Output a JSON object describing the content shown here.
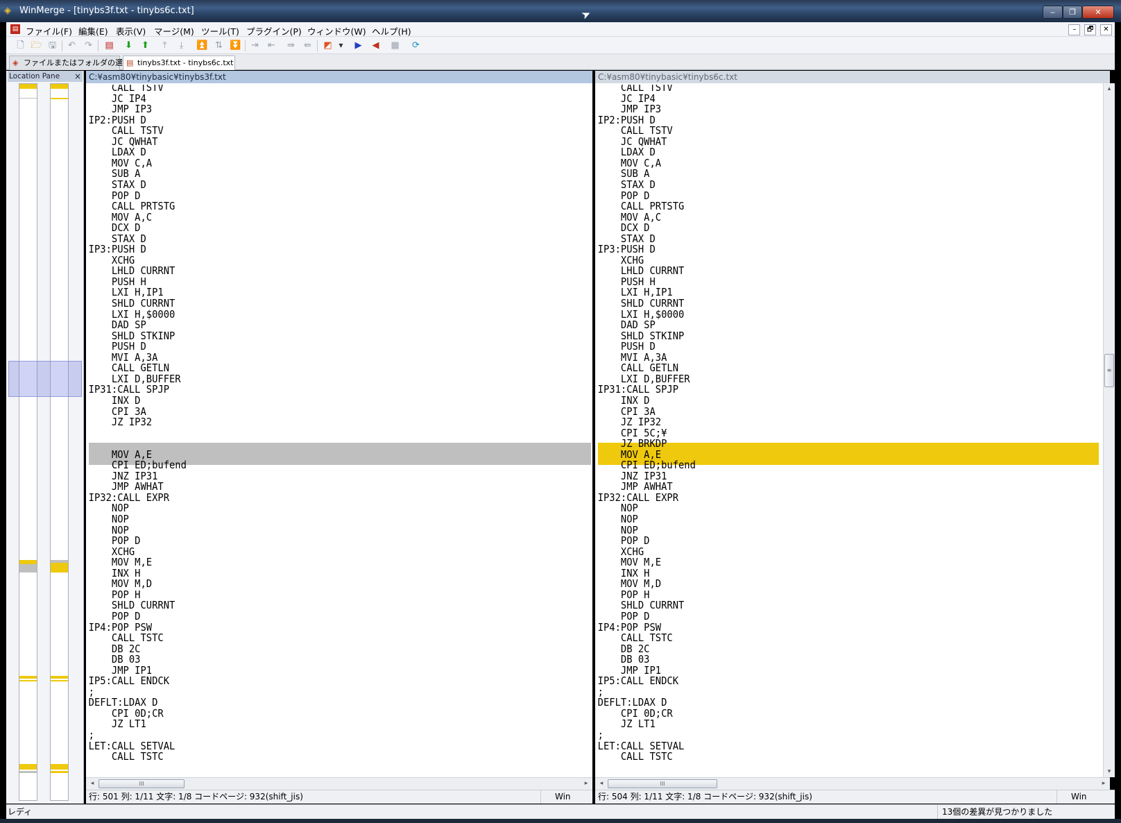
{
  "window": {
    "title": "WinMerge - [tinybs3f.txt - tinybs6c.txt]",
    "min_label": "‒",
    "max_label": "❐",
    "close_label": "✕"
  },
  "menu": {
    "items": [
      "ファイル(F)",
      "編集(E)",
      "表示(V)",
      "マージ(M)",
      "ツール(T)",
      "プラグイン(P)",
      "ウィンドウ(W)",
      "ヘルプ(H)"
    ],
    "mdi_min": "–",
    "mdi_restore": "🗗",
    "mdi_close": "✕"
  },
  "toolbar": {
    "icons": [
      "new-icon",
      "open-icon",
      "save-icon",
      "undo-icon",
      "redo-icon",
      "options-icon",
      "next-diff-icon",
      "prev-diff-icon",
      "first-diff-icon",
      "last-diff-icon",
      "current-diff-icon",
      "next-conflict-icon",
      "copy-right-icon",
      "copy-left-icon",
      "all-right-icon",
      "all-left-icon",
      "edit-icon",
      "open-left-icon",
      "open-right-icon",
      "location-pane-icon",
      "refresh-icon"
    ]
  },
  "tabs": [
    {
      "label": "ファイルまたはフォルダの選択...",
      "active": false
    },
    {
      "label": "tinybs3f.txt - tinybs6c.txt",
      "active": true
    }
  ],
  "location_pane": {
    "title": "Location Pane",
    "close_label": "×"
  },
  "left_pane": {
    "path": "C:¥asm80¥tinybasic¥tinybs3f.txt",
    "lines_before": [
      "    CALL TSTV",
      "    JC IP4",
      "    JMP IP3",
      "IP2:PUSH D",
      "    CALL TSTV",
      "    JC QWHAT",
      "    LDAX D",
      "    MOV C,A",
      "    SUB A",
      "    STAX D",
      "    POP D",
      "    CALL PRTSTG",
      "    MOV A,C",
      "    DCX D",
      "    STAX D",
      "IP3:PUSH D",
      "    XCHG",
      "    LHLD CURRNT",
      "    PUSH H",
      "    LXI H,IP1",
      "    SHLD CURRNT",
      "    LXI H,$0000",
      "    DAD SP",
      "    SHLD STKINP",
      "    PUSH D",
      "    MVI A,3A",
      "    CALL GETLN",
      "    LXI D,BUFFER",
      "IP31:CALL SPJP",
      "    INX D",
      "    CPI 3A",
      "    JZ IP32"
    ],
    "diff_lines": [
      "",
      ""
    ],
    "lines_after": [
      "    MOV A,E",
      "    CPI ED;bufend",
      "    JNZ IP31",
      "    JMP AWHAT",
      "IP32:CALL EXPR",
      "    NOP",
      "    NOP",
      "    NOP",
      "    POP D",
      "    XCHG",
      "    MOV M,E",
      "    INX H",
      "    MOV M,D",
      "    POP H",
      "    SHLD CURRNT",
      "    POP D",
      "IP4:POP PSW",
      "    CALL TSTC",
      "    DB 2C",
      "    DB 03",
      "    JMP IP1",
      "IP5:CALL ENDCK",
      ";",
      "DEFLT:LDAX D",
      "    CPI 0D;CR",
      "    JZ LT1",
      ";",
      "LET:CALL SETVAL",
      "    CALL TSTC"
    ],
    "status_pos": "行: 501  列: 1/11  文字: 1/8  コードページ: 932(shift_jis)",
    "status_eol": "Win",
    "hscroll_thumb": "III",
    "arrow_left": "◂",
    "arrow_right": "▸"
  },
  "right_pane": {
    "path": "C:¥asm80¥tinybasic¥tinybs6c.txt",
    "lines_before": [
      "    CALL TSTV",
      "    JC IP4",
      "    JMP IP3",
      "IP2:PUSH D",
      "    CALL TSTV",
      "    JC QWHAT",
      "    LDAX D",
      "    MOV C,A",
      "    SUB A",
      "    STAX D",
      "    POP D",
      "    CALL PRTSTG",
      "    MOV A,C",
      "    DCX D",
      "    STAX D",
      "IP3:PUSH D",
      "    XCHG",
      "    LHLD CURRNT",
      "    PUSH H",
      "    LXI H,IP1",
      "    SHLD CURRNT",
      "    LXI H,$0000",
      "    DAD SP",
      "    SHLD STKINP",
      "    PUSH D",
      "    MVI A,3A",
      "    CALL GETLN",
      "    LXI D,BUFFER",
      "IP31:CALL SPJP",
      "    INX D",
      "    CPI 3A",
      "    JZ IP32"
    ],
    "diff_lines": [
      "    CPI 5C;¥",
      "    JZ BRKDP"
    ],
    "lines_after": [
      "    MOV A,E",
      "    CPI ED;bufend",
      "    JNZ IP31",
      "    JMP AWHAT",
      "IP32:CALL EXPR",
      "    NOP",
      "    NOP",
      "    NOP",
      "    POP D",
      "    XCHG",
      "    MOV M,E",
      "    INX H",
      "    MOV M,D",
      "    POP H",
      "    SHLD CURRNT",
      "    POP D",
      "IP4:POP PSW",
      "    CALL TSTC",
      "    DB 2C",
      "    DB 03",
      "    JMP IP1",
      "IP5:CALL ENDCK",
      ";",
      "DEFLT:LDAX D",
      "    CPI 0D;CR",
      "    JZ LT1",
      ";",
      "LET:CALL SETVAL",
      "    CALL TSTC"
    ],
    "status_pos": "行: 504  列: 1/11  文字: 1/8  コードページ: 932(shift_jis)",
    "status_eol": "Win",
    "hscroll_thumb": "III",
    "arrow_left": "◂",
    "arrow_right": "▸"
  },
  "vscroll": {
    "arrow_up": "▴",
    "arrow_down": "▾",
    "thumb_grip": "≡"
  },
  "colors": {
    "diff_changed": "#efc90d",
    "diff_missing": "#bfbfbf",
    "selected_path_header": "#b3c7e1"
  },
  "statusbar": {
    "ready": "レディ",
    "diff_count": "13個の差異が見つかりました"
  }
}
